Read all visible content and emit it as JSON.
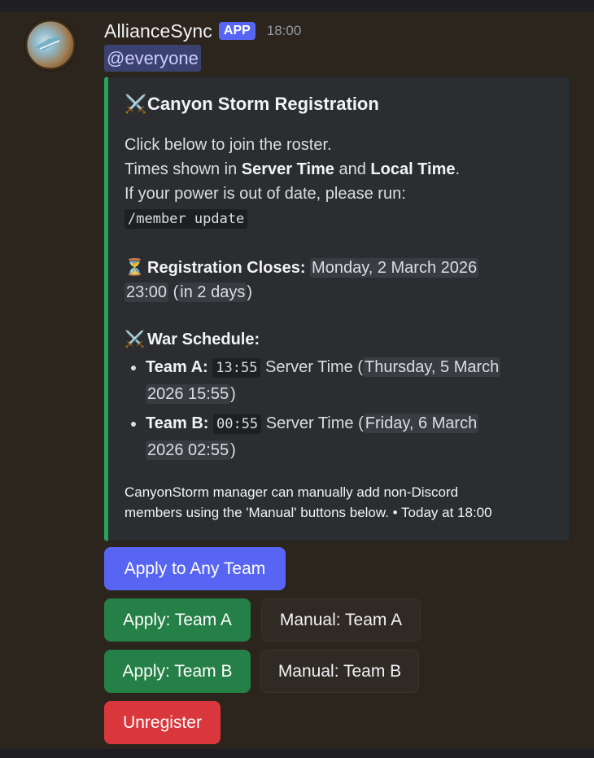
{
  "message": {
    "username": "AllianceSync",
    "badge": "APP",
    "timestamp": "18:00",
    "mention": "@everyone"
  },
  "embed": {
    "accent_color": "#23a55a",
    "title_emoji": "⚔️",
    "title": "Canyon Storm Registration",
    "lines": {
      "l1": "Click below to join the roster.",
      "l2_pre": "Times shown in ",
      "l2_b1": "Server Time",
      "l2_mid": " and ",
      "l2_b2": "Local Time",
      "l2_post": ".",
      "l3": "If your power is out of date, please run:",
      "command": "/member update"
    },
    "closes": {
      "emoji": "⏳",
      "label": "Registration Closes:",
      "date_part1": "Monday, 2 March 2026",
      "date_part2": "23:00",
      "relative": "in 2 days"
    },
    "schedule": {
      "emoji": "⚔️",
      "label": "War Schedule:",
      "teams": [
        {
          "name": "Team A:",
          "time": "13:55",
          "server_label": "Server Time",
          "local_part1": "Thursday, 5 March",
          "local_part2": "2026 15:55"
        },
        {
          "name": "Team B:",
          "time": "00:55",
          "server_label": "Server Time",
          "local_part1": "Friday, 6 March",
          "local_part2": "2026 02:55"
        }
      ]
    },
    "footer_line1": "CanyonStorm manager can manually add non-Discord",
    "footer_line2": "members using the 'Manual' buttons below. • Today at 18:00"
  },
  "buttons": {
    "apply_any": "Apply to Any Team",
    "apply_a": "Apply: Team A",
    "manual_a": "Manual: Team A",
    "apply_b": "Apply: Team B",
    "manual_b": "Manual: Team B",
    "unregister": "Unregister"
  },
  "colors": {
    "blurple": "#5865f2",
    "green": "#248046",
    "red": "#da373c"
  }
}
